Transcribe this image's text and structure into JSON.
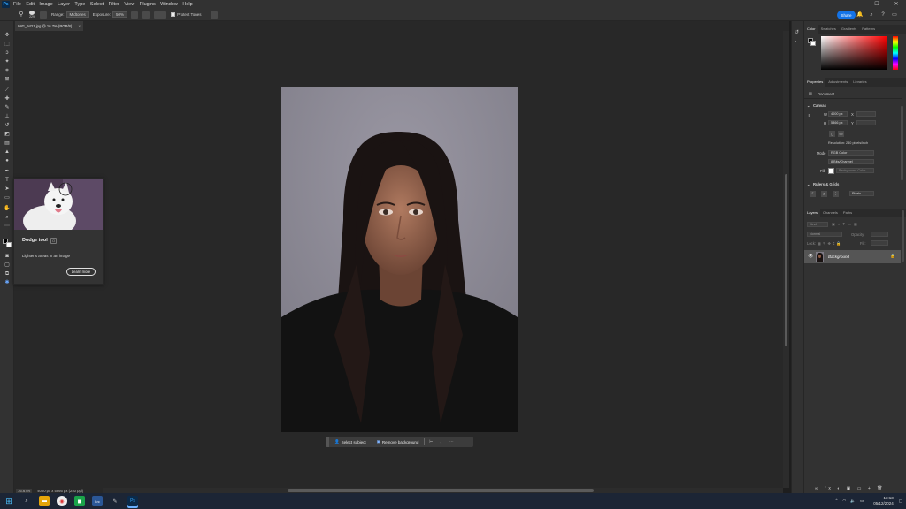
{
  "app": {
    "menu": [
      "File",
      "Edit",
      "Image",
      "Layer",
      "Type",
      "Select",
      "Filter",
      "View",
      "Plugins",
      "Window",
      "Help"
    ],
    "logo": "Ps"
  },
  "options": {
    "range_label": "Range:",
    "range_value": "Midtones",
    "exposure_label": "Exposure:",
    "exposure_value": "50%",
    "brush_size": "229",
    "protect_tones": "Protect Tones"
  },
  "share_label": "Share",
  "tab": {
    "title": "IMG_9421.jpg @ 16.7% (RGB/8)"
  },
  "status": {
    "zoom": "16.67%",
    "doc_info": "4000 px x 5866 px (240 ppi)"
  },
  "context_bar": {
    "select_subject": "Select subject",
    "remove_background": "Remove background"
  },
  "tooltip": {
    "title": "Dodge tool",
    "description": "Lightens areas in an image",
    "learn_more": "Learn more"
  },
  "color_panel": {
    "tabs": [
      "Color",
      "Swatches",
      "Gradients",
      "Patterns"
    ]
  },
  "properties": {
    "tabs": [
      "Properties",
      "Adjustments",
      "Libraries"
    ],
    "document_label": "Document",
    "canvas_label": "Canvas",
    "width": "4000 px",
    "height": "5866 px",
    "x_label": "X",
    "y_label": "Y",
    "w_label": "W",
    "h_label": "H",
    "resolution": "Resolution: 240 pixels/inch",
    "mode_label": "Mode",
    "mode_value": "RGB Color",
    "bit_depth": "8 Bits/Channel",
    "fill_label": "Fill",
    "fill_value": "Background Color",
    "rulers_label": "Rulers & Grids",
    "units": "Pixels"
  },
  "layers": {
    "tabs": [
      "Layers",
      "Channels",
      "Paths"
    ],
    "kind_label": "Kind",
    "blend_mode": "Normal",
    "opacity_label": "Opacity:",
    "lock_label": "Lock:",
    "fill_label": "Fill:",
    "layer_name": "Background"
  },
  "taskbar": {
    "time": "13:13",
    "date": "05/12/2024"
  },
  "colors": {
    "accent": "#1473e6",
    "panel": "#323232",
    "canvas": "#282828"
  }
}
